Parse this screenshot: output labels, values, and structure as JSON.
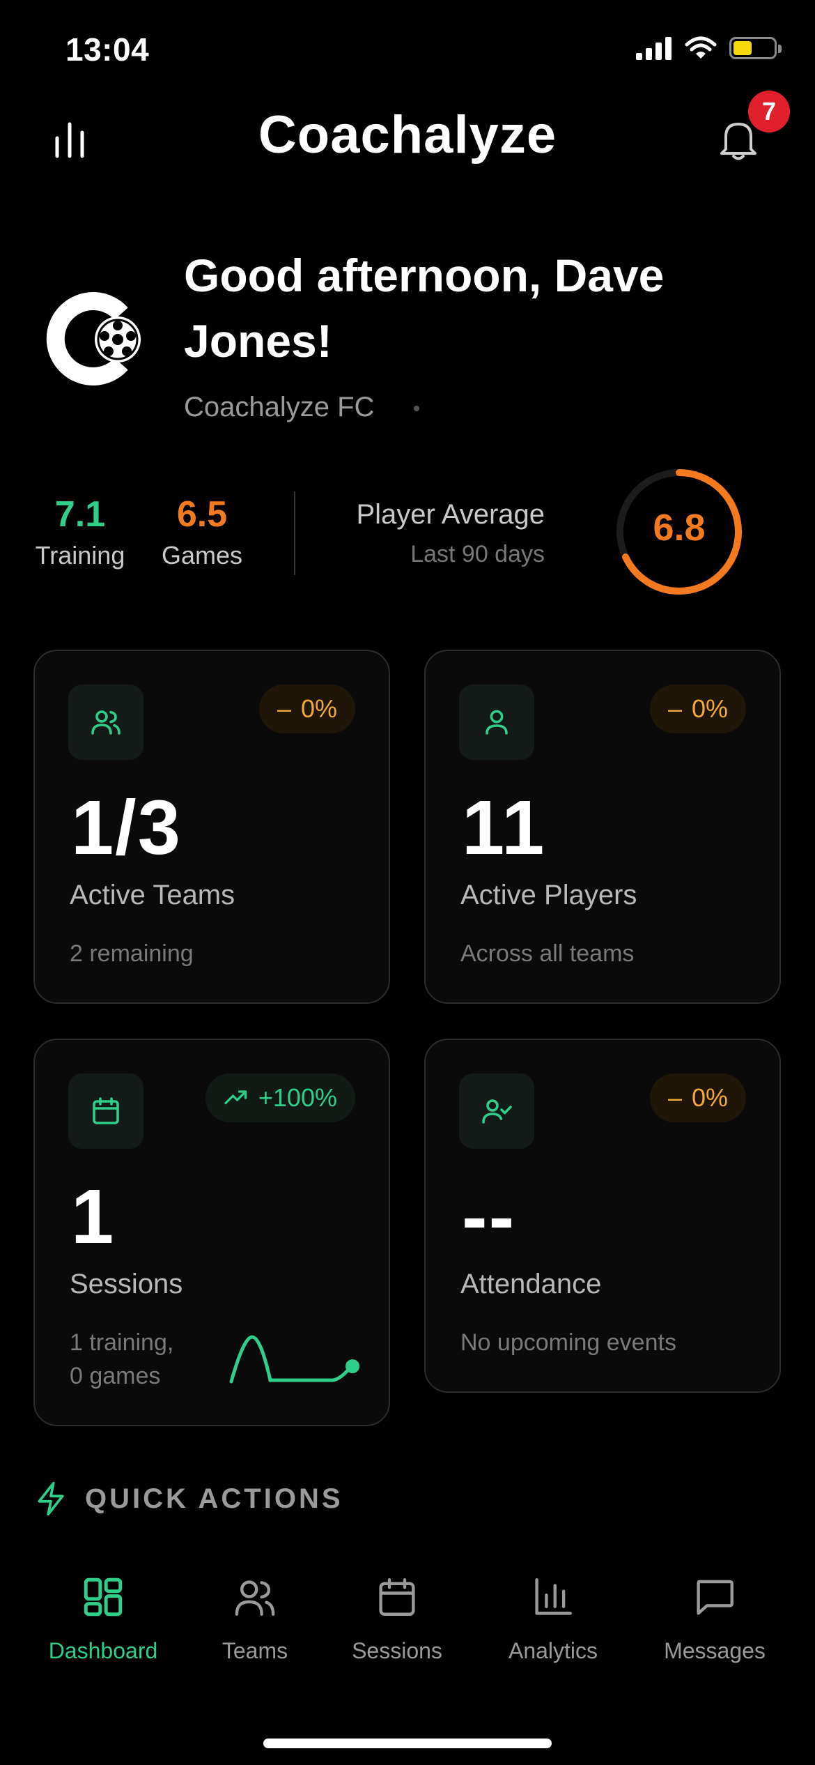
{
  "status_bar": {
    "time": "13:04"
  },
  "header": {
    "brand": "Coachalyze",
    "notification_count": "7"
  },
  "greeting": {
    "text": "Good afternoon, Dave Jones!",
    "club": "Coachalyze FC"
  },
  "ratings": {
    "training": {
      "value": "7.1",
      "label": "Training",
      "color": "#2fcf8a"
    },
    "games": {
      "value": "6.5",
      "label": "Games",
      "color": "#f47a20"
    },
    "player_average": {
      "title": "Player Average",
      "subtitle": "Last 90 days",
      "value": "6.8",
      "fraction": 0.68
    }
  },
  "cards": [
    {
      "icon": "users-icon",
      "pill": "0%",
      "trend": "neutral",
      "value": "1/3",
      "label": "Active Teams",
      "sub": "2 remaining"
    },
    {
      "icon": "user-icon",
      "pill": "0%",
      "trend": "neutral",
      "value": "11",
      "label": "Active Players",
      "sub": "Across all teams"
    },
    {
      "icon": "calendar-icon",
      "pill": "+100%",
      "trend": "up",
      "value": "1",
      "label": "Sessions",
      "sub_line1": "1 training,",
      "sub_line2": "0 games"
    },
    {
      "icon": "user-check-icon",
      "pill": "0%",
      "trend": "neutral",
      "value": "--",
      "label": "Attendance",
      "sub": "No upcoming events"
    }
  ],
  "quick_actions": {
    "title": "QUICK ACTIONS"
  },
  "tabs": [
    {
      "label": "Dashboard",
      "icon": "dashboard-icon",
      "active": true
    },
    {
      "label": "Teams",
      "icon": "users-icon"
    },
    {
      "label": "Sessions",
      "icon": "calendar-icon"
    },
    {
      "label": "Analytics",
      "icon": "bar-chart-icon"
    },
    {
      "label": "Messages",
      "icon": "message-icon"
    }
  ],
  "colors": {
    "accent_green": "#2fcf8a",
    "accent_orange": "#f47a20",
    "badge_red": "#e0202b",
    "neutral_amber": "#f2a93b"
  }
}
